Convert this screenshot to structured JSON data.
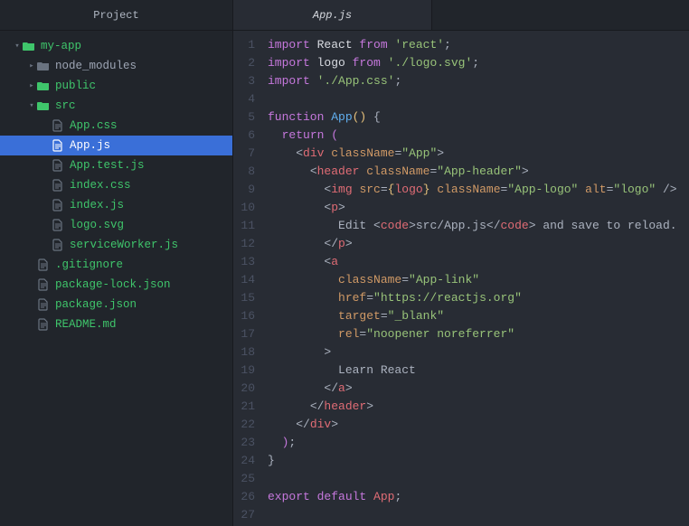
{
  "sidebar": {
    "title": "Project",
    "tree": [
      {
        "depth": 0,
        "arrow": "down",
        "icon": "folder-open",
        "label": "my-app",
        "color": "green"
      },
      {
        "depth": 1,
        "arrow": "right",
        "icon": "folder-closed",
        "label": "node_modules",
        "color": "grey"
      },
      {
        "depth": 1,
        "arrow": "right",
        "icon": "folder-open",
        "label": "public",
        "color": "green"
      },
      {
        "depth": 1,
        "arrow": "down",
        "icon": "folder-open",
        "label": "src",
        "color": "green"
      },
      {
        "depth": 2,
        "arrow": "",
        "icon": "file",
        "label": "App.css",
        "color": "green"
      },
      {
        "depth": 2,
        "arrow": "",
        "icon": "file",
        "label": "App.js",
        "color": "white",
        "selected": true
      },
      {
        "depth": 2,
        "arrow": "",
        "icon": "file",
        "label": "App.test.js",
        "color": "green"
      },
      {
        "depth": 2,
        "arrow": "",
        "icon": "file",
        "label": "index.css",
        "color": "green"
      },
      {
        "depth": 2,
        "arrow": "",
        "icon": "file",
        "label": "index.js",
        "color": "green"
      },
      {
        "depth": 2,
        "arrow": "",
        "icon": "file",
        "label": "logo.svg",
        "color": "green"
      },
      {
        "depth": 2,
        "arrow": "",
        "icon": "file",
        "label": "serviceWorker.js",
        "color": "green"
      },
      {
        "depth": 1,
        "arrow": "",
        "icon": "file",
        "label": ".gitignore",
        "color": "green"
      },
      {
        "depth": 1,
        "arrow": "",
        "icon": "file",
        "label": "package-lock.json",
        "color": "green"
      },
      {
        "depth": 1,
        "arrow": "",
        "icon": "file",
        "label": "package.json",
        "color": "green"
      },
      {
        "depth": 1,
        "arrow": "",
        "icon": "file",
        "label": "README.md",
        "color": "green"
      }
    ]
  },
  "editor": {
    "tab": "App.js",
    "lines": [
      [
        {
          "t": "import ",
          "c": "c-kw"
        },
        {
          "t": "React",
          "c": "c-white"
        },
        {
          "t": " from ",
          "c": "c-kw"
        },
        {
          "t": "'react'",
          "c": "c-str"
        },
        {
          "t": ";",
          "c": "c-punc"
        }
      ],
      [
        {
          "t": "import ",
          "c": "c-kw"
        },
        {
          "t": "logo",
          "c": "c-white"
        },
        {
          "t": " from ",
          "c": "c-kw"
        },
        {
          "t": "'./logo.svg'",
          "c": "c-str"
        },
        {
          "t": ";",
          "c": "c-punc"
        }
      ],
      [
        {
          "t": "import ",
          "c": "c-kw"
        },
        {
          "t": "'./App.css'",
          "c": "c-str"
        },
        {
          "t": ";",
          "c": "c-punc"
        }
      ],
      [],
      [
        {
          "t": "function ",
          "c": "c-kw"
        },
        {
          "t": "App",
          "c": "c-def"
        },
        {
          "t": "()",
          "c": "c-yellow"
        },
        {
          "t": " {",
          "c": "c-punc"
        }
      ],
      [
        {
          "t": "  ",
          "c": ""
        },
        {
          "t": "return ",
          "c": "c-kw"
        },
        {
          "t": "(",
          "c": "c-brace"
        }
      ],
      [
        {
          "t": "    ",
          "c": ""
        },
        {
          "t": "<",
          "c": "c-punc"
        },
        {
          "t": "div",
          "c": "c-tag"
        },
        {
          "t": " className",
          "c": "c-attr"
        },
        {
          "t": "=",
          "c": "c-punc"
        },
        {
          "t": "\"App\"",
          "c": "c-str"
        },
        {
          "t": ">",
          "c": "c-punc"
        }
      ],
      [
        {
          "t": "      ",
          "c": ""
        },
        {
          "t": "<",
          "c": "c-punc"
        },
        {
          "t": "header",
          "c": "c-tag"
        },
        {
          "t": " className",
          "c": "c-attr"
        },
        {
          "t": "=",
          "c": "c-punc"
        },
        {
          "t": "\"App-header\"",
          "c": "c-str"
        },
        {
          "t": ">",
          "c": "c-punc"
        }
      ],
      [
        {
          "t": "        ",
          "c": ""
        },
        {
          "t": "<",
          "c": "c-punc"
        },
        {
          "t": "img",
          "c": "c-tag"
        },
        {
          "t": " src",
          "c": "c-attr"
        },
        {
          "t": "=",
          "c": "c-punc"
        },
        {
          "t": "{",
          "c": "c-yellow"
        },
        {
          "t": "logo",
          "c": "c-red"
        },
        {
          "t": "}",
          "c": "c-yellow"
        },
        {
          "t": " className",
          "c": "c-attr"
        },
        {
          "t": "=",
          "c": "c-punc"
        },
        {
          "t": "\"App-logo\"",
          "c": "c-str"
        },
        {
          "t": " alt",
          "c": "c-attr"
        },
        {
          "t": "=",
          "c": "c-punc"
        },
        {
          "t": "\"logo\"",
          "c": "c-str"
        },
        {
          "t": " />",
          "c": "c-punc"
        }
      ],
      [
        {
          "t": "        ",
          "c": ""
        },
        {
          "t": "<",
          "c": "c-punc"
        },
        {
          "t": "p",
          "c": "c-tag"
        },
        {
          "t": ">",
          "c": "c-punc"
        }
      ],
      [
        {
          "t": "          Edit ",
          "c": "c-text"
        },
        {
          "t": "<",
          "c": "c-punc"
        },
        {
          "t": "code",
          "c": "c-tag"
        },
        {
          "t": ">",
          "c": "c-punc"
        },
        {
          "t": "src/App.js",
          "c": "c-text"
        },
        {
          "t": "</",
          "c": "c-punc"
        },
        {
          "t": "code",
          "c": "c-tag"
        },
        {
          "t": ">",
          "c": "c-punc"
        },
        {
          "t": " and save to reload.",
          "c": "c-text"
        }
      ],
      [
        {
          "t": "        ",
          "c": ""
        },
        {
          "t": "</",
          "c": "c-punc"
        },
        {
          "t": "p",
          "c": "c-tag"
        },
        {
          "t": ">",
          "c": "c-punc"
        }
      ],
      [
        {
          "t": "        ",
          "c": ""
        },
        {
          "t": "<",
          "c": "c-punc"
        },
        {
          "t": "a",
          "c": "c-tag"
        }
      ],
      [
        {
          "t": "          ",
          "c": ""
        },
        {
          "t": "className",
          "c": "c-attr"
        },
        {
          "t": "=",
          "c": "c-punc"
        },
        {
          "t": "\"App-link\"",
          "c": "c-str"
        }
      ],
      [
        {
          "t": "          ",
          "c": ""
        },
        {
          "t": "href",
          "c": "c-attr"
        },
        {
          "t": "=",
          "c": "c-punc"
        },
        {
          "t": "\"https://reactjs.org\"",
          "c": "c-str"
        }
      ],
      [
        {
          "t": "          ",
          "c": ""
        },
        {
          "t": "target",
          "c": "c-attr"
        },
        {
          "t": "=",
          "c": "c-punc"
        },
        {
          "t": "\"_blank\"",
          "c": "c-str"
        }
      ],
      [
        {
          "t": "          ",
          "c": ""
        },
        {
          "t": "rel",
          "c": "c-attr"
        },
        {
          "t": "=",
          "c": "c-punc"
        },
        {
          "t": "\"noopener noreferrer\"",
          "c": "c-str"
        }
      ],
      [
        {
          "t": "        ",
          "c": ""
        },
        {
          "t": ">",
          "c": "c-punc"
        }
      ],
      [
        {
          "t": "          Learn React",
          "c": "c-text"
        }
      ],
      [
        {
          "t": "        ",
          "c": ""
        },
        {
          "t": "</",
          "c": "c-punc"
        },
        {
          "t": "a",
          "c": "c-tag"
        },
        {
          "t": ">",
          "c": "c-punc"
        }
      ],
      [
        {
          "t": "      ",
          "c": ""
        },
        {
          "t": "</",
          "c": "c-punc"
        },
        {
          "t": "header",
          "c": "c-tag"
        },
        {
          "t": ">",
          "c": "c-punc"
        }
      ],
      [
        {
          "t": "    ",
          "c": ""
        },
        {
          "t": "</",
          "c": "c-punc"
        },
        {
          "t": "div",
          "c": "c-tag"
        },
        {
          "t": ">",
          "c": "c-punc"
        }
      ],
      [
        {
          "t": "  ",
          "c": ""
        },
        {
          "t": ")",
          "c": "c-brace"
        },
        {
          "t": ";",
          "c": "c-punc"
        }
      ],
      [
        {
          "t": "}",
          "c": "c-punc"
        }
      ],
      [],
      [
        {
          "t": "export ",
          "c": "c-kw"
        },
        {
          "t": "default ",
          "c": "c-kw"
        },
        {
          "t": "App",
          "c": "c-red"
        },
        {
          "t": ";",
          "c": "c-punc"
        }
      ],
      []
    ]
  }
}
